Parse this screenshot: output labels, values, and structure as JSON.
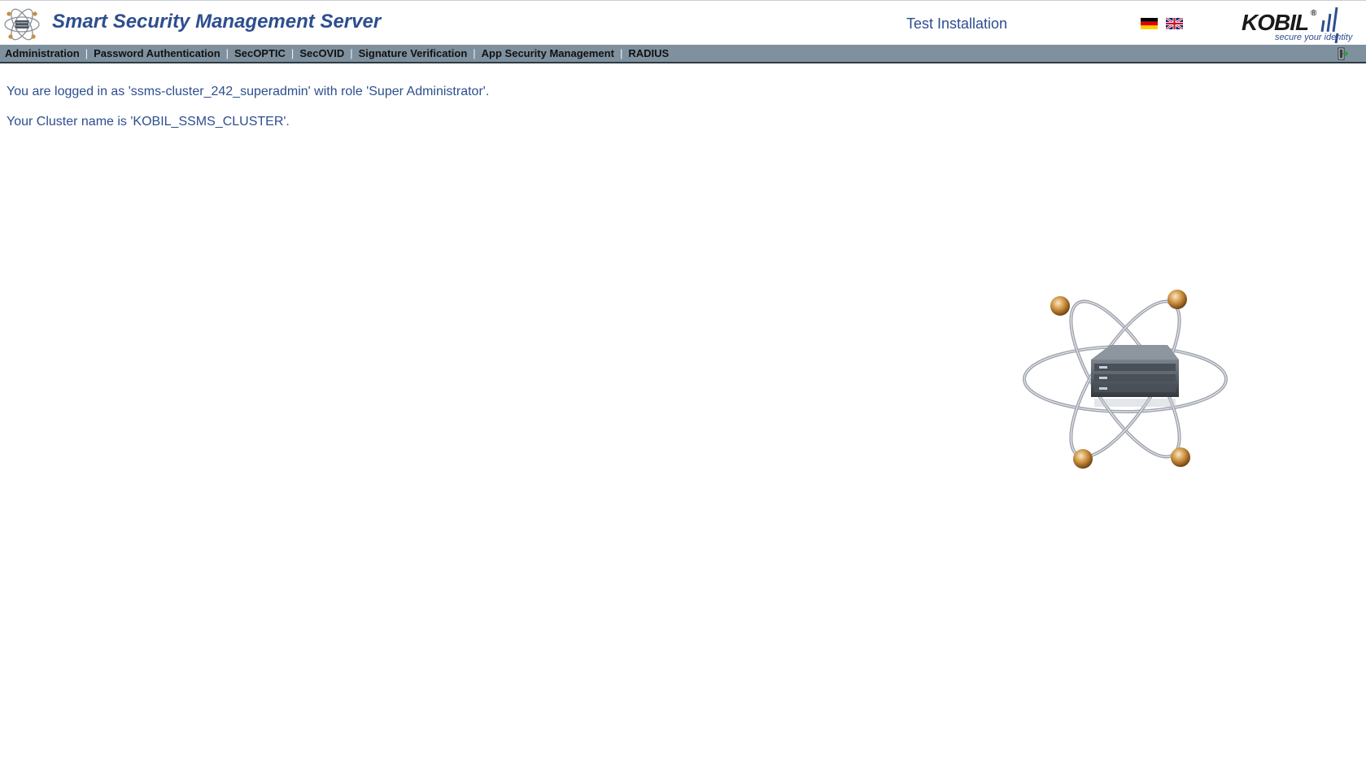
{
  "header": {
    "title": "Smart Security Management Server",
    "installation_label": "Test Installation",
    "languages": [
      {
        "name": "German",
        "icon": "german-flag-icon"
      },
      {
        "name": "English",
        "icon": "uk-flag-icon"
      }
    ],
    "brand": {
      "name": "KOBIL",
      "registered_mark": "®",
      "tagline": "secure your identity"
    }
  },
  "nav": {
    "items": [
      {
        "label": "Administration"
      },
      {
        "label": "Password Authentication"
      },
      {
        "label": "SecOPTIC"
      },
      {
        "label": "SecOVID"
      },
      {
        "label": "Signature Verification"
      },
      {
        "label": "App Security Management"
      },
      {
        "label": "RADIUS"
      }
    ],
    "separator": "|",
    "logout_icon": "logout-icon"
  },
  "main": {
    "login_message": "You are logged in as 'ssms-cluster_242_superadmin' with role 'Super Administrator'.",
    "cluster_message": "Your Cluster name is 'KOBIL_SSMS_CLUSTER'."
  },
  "colors": {
    "title_blue": "#2d4e8f",
    "navbar_bg": "#7f919f",
    "navbar_border": "#2f3a44"
  }
}
